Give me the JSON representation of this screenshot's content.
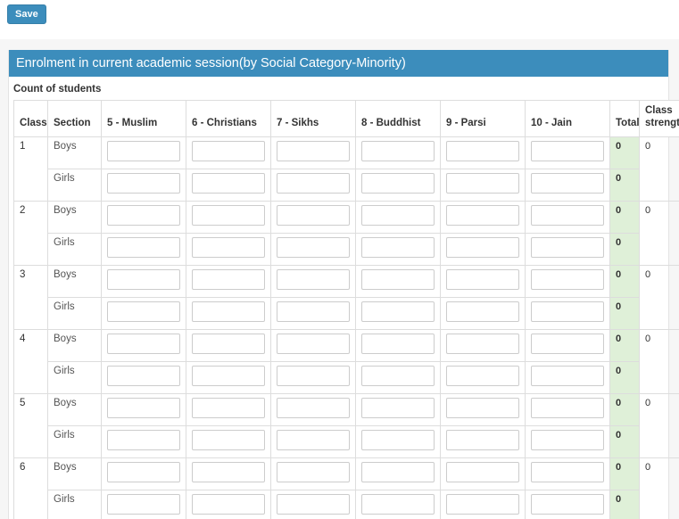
{
  "toolbar": {
    "save_label": "Save"
  },
  "panel": {
    "title": "Enrolment in current academic session(by Social Category-Minority)",
    "subtitle": "Count of students",
    "header_bg": "#3c8dbc",
    "total_bg": "#dff0d8"
  },
  "table": {
    "headers": {
      "class": "Class",
      "section": "Section",
      "total": "Total",
      "strength": "Class strength"
    },
    "minority_columns": [
      "5 - Muslim",
      "6 - Christians",
      "7 - Sikhs",
      "8 - Buddhist",
      "9 - Parsi",
      "10 - Jain"
    ],
    "section_labels": {
      "boys": "Boys",
      "girls": "Girls"
    },
    "input_value": "",
    "rows": [
      {
        "class": "1",
        "class_strength": "0",
        "sections": [
          {
            "section": "Boys",
            "values": [
              "",
              "",
              "",
              "",
              "",
              ""
            ],
            "total": "0"
          },
          {
            "section": "Girls",
            "values": [
              "",
              "",
              "",
              "",
              "",
              ""
            ],
            "total": "0"
          }
        ]
      },
      {
        "class": "2",
        "class_strength": "0",
        "sections": [
          {
            "section": "Boys",
            "values": [
              "",
              "",
              "",
              "",
              "",
              ""
            ],
            "total": "0"
          },
          {
            "section": "Girls",
            "values": [
              "",
              "",
              "",
              "",
              "",
              ""
            ],
            "total": "0"
          }
        ]
      },
      {
        "class": "3",
        "class_strength": "0",
        "sections": [
          {
            "section": "Boys",
            "values": [
              "",
              "",
              "",
              "",
              "",
              ""
            ],
            "total": "0"
          },
          {
            "section": "Girls",
            "values": [
              "",
              "",
              "",
              "",
              "",
              ""
            ],
            "total": "0"
          }
        ]
      },
      {
        "class": "4",
        "class_strength": "0",
        "sections": [
          {
            "section": "Boys",
            "values": [
              "",
              "",
              "",
              "",
              "",
              ""
            ],
            "total": "0"
          },
          {
            "section": "Girls",
            "values": [
              "",
              "",
              "",
              "",
              "",
              ""
            ],
            "total": "0"
          }
        ]
      },
      {
        "class": "5",
        "class_strength": "0",
        "sections": [
          {
            "section": "Boys",
            "values": [
              "",
              "",
              "",
              "",
              "",
              ""
            ],
            "total": "0"
          },
          {
            "section": "Girls",
            "values": [
              "",
              "",
              "",
              "",
              "",
              ""
            ],
            "total": "0"
          }
        ]
      },
      {
        "class": "6",
        "class_strength": "0",
        "sections": [
          {
            "section": "Boys",
            "values": [
              "",
              "",
              "",
              "",
              "",
              ""
            ],
            "total": "0"
          },
          {
            "section": "Girls",
            "values": [
              "",
              "",
              "",
              "",
              "",
              ""
            ],
            "total": "0"
          }
        ]
      }
    ]
  }
}
